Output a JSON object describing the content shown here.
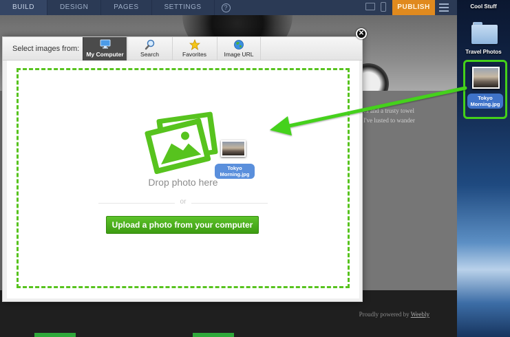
{
  "topbar": {
    "nav": [
      "BUILD",
      "DESIGN",
      "PAGES",
      "SETTINGS"
    ],
    "help_glyph": "?",
    "publish_label": "PUBLISH"
  },
  "page": {
    "text_line1": "es and a trusty towel",
    "text_line2": "I've lusted to wander",
    "footer_prefix": "Proudly powered by",
    "footer_brand": "Weebly"
  },
  "desktop": {
    "top_label": "Cool Stuff",
    "folder_label": "Travel Photos",
    "file_label_line1": "Tokyo",
    "file_label_line2": "Morning.jpg"
  },
  "modal": {
    "select_label": "Select images from:",
    "tabs": [
      {
        "label": "My Computer",
        "icon": "monitor-icon",
        "active": true
      },
      {
        "label": "Search",
        "icon": "magnifier-icon",
        "active": false
      },
      {
        "label": "Favorites",
        "icon": "star-icon",
        "active": false
      },
      {
        "label": "Image URL",
        "icon": "globe-icon",
        "active": false
      }
    ],
    "close_glyph": "✕",
    "drop_text": "Drop photo here",
    "or_text": "or",
    "upload_label": "Upload a photo from your computer",
    "drag_label_line1": "Tokyo",
    "drag_label_line2": "Morning.jpg"
  },
  "colors": {
    "accent_green": "#57c31e",
    "arrow_green": "#44d11a",
    "topbar": "#2b3a55",
    "publish": "#e08a1e"
  }
}
